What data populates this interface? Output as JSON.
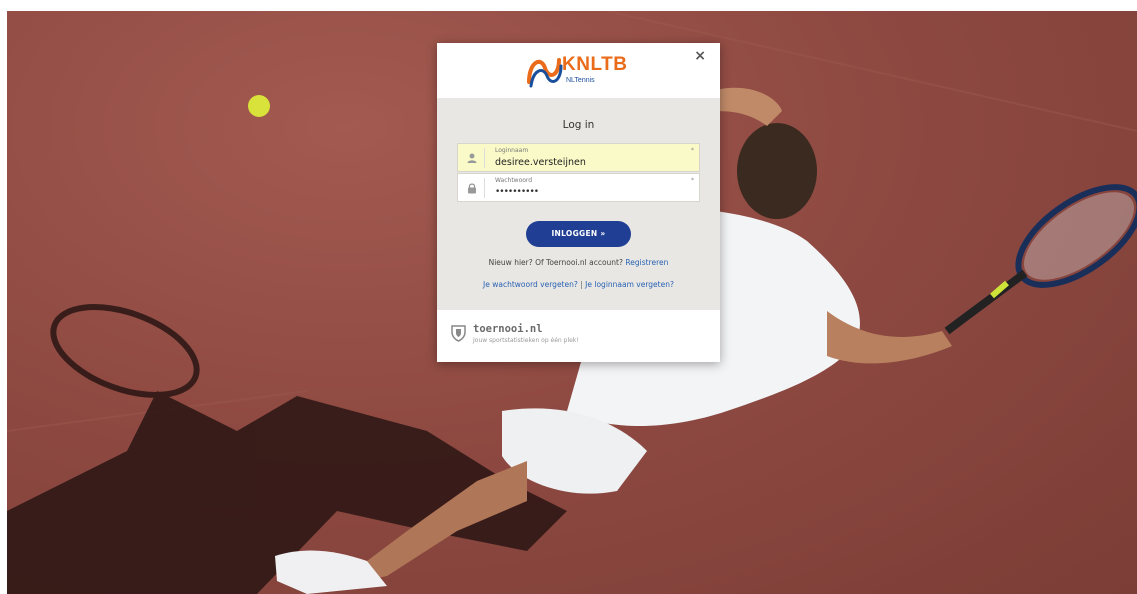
{
  "modal": {
    "close_symbol": "×",
    "brand": {
      "name": "KNLTB",
      "sub": "NLTennis",
      "colors": {
        "orange": "#ea6b1a",
        "blue": "#1b4f9c"
      }
    },
    "title": "Log in",
    "username": {
      "label": "Loginnaam",
      "value": "desiree.versteijnen",
      "required": "*",
      "icon": "user-icon"
    },
    "password": {
      "label": "Wachtwoord",
      "value": "••••••••••",
      "required": "*",
      "icon": "lock-icon"
    },
    "login_button": "INLOGGEN »",
    "new_here": {
      "text": "Nieuw hier? Of Toernooi.nl account?",
      "link": "Registreren"
    },
    "forgot": {
      "password_link": "Je wachtwoord vergeten?",
      "separator": "|",
      "username_link": "Je loginnaam vergeten?"
    },
    "footer": {
      "name": "toernooi.nl",
      "tagline": "Jouw sportstatistieken op één plek!",
      "icon": "shield-icon"
    }
  },
  "colors": {
    "court": "#8f4a42",
    "primary_button": "#1f3e94",
    "link": "#2a62b5",
    "autofill": "#fafac8"
  }
}
